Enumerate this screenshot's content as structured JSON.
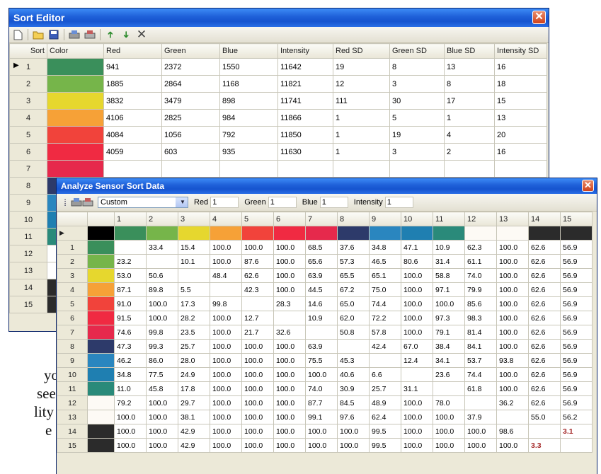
{
  "background_text": [
    "you",
    "see",
    "lity",
    "e"
  ],
  "sort_editor": {
    "title": "Sort Editor",
    "toolbar": [
      "new-icon",
      "open-icon",
      "save-icon",
      "sep",
      "scan-icon",
      "scan2-icon",
      "sep",
      "move-up-icon",
      "move-down-icon",
      "delete-icon"
    ],
    "columns": [
      "Sort",
      "Color",
      "Red",
      "Green",
      "Blue",
      "Intensity",
      "Red SD",
      "Green SD",
      "Blue SD",
      "Intensity SD"
    ],
    "rows": [
      {
        "sort": "1",
        "color": "#3a8f5b",
        "red": "941",
        "green": "2372",
        "blue": "1550",
        "intensity": "11642",
        "red_sd": "19",
        "green_sd": "8",
        "blue_sd": "13",
        "intensity_sd": "16"
      },
      {
        "sort": "2",
        "color": "#76b54a",
        "red": "1885",
        "green": "2864",
        "blue": "1168",
        "intensity": "11821",
        "red_sd": "12",
        "green_sd": "3",
        "blue_sd": "8",
        "intensity_sd": "18"
      },
      {
        "sort": "3",
        "color": "#e6d72e",
        "red": "3832",
        "green": "3479",
        "blue": "898",
        "intensity": "11741",
        "red_sd": "111",
        "green_sd": "30",
        "blue_sd": "17",
        "intensity_sd": "15"
      },
      {
        "sort": "4",
        "color": "#f6a137",
        "red": "4106",
        "green": "2825",
        "blue": "984",
        "intensity": "11866",
        "red_sd": "1",
        "green_sd": "5",
        "blue_sd": "1",
        "intensity_sd": "13"
      },
      {
        "sort": "5",
        "color": "#f1433b",
        "red": "4084",
        "green": "1056",
        "blue": "792",
        "intensity": "11850",
        "red_sd": "1",
        "green_sd": "19",
        "blue_sd": "4",
        "intensity_sd": "20"
      },
      {
        "sort": "6",
        "color": "#f02a42",
        "red": "4059",
        "green": "603",
        "blue": "935",
        "intensity": "11630",
        "red_sd": "1",
        "green_sd": "3",
        "blue_sd": "2",
        "intensity_sd": "16"
      }
    ],
    "hidden_rows": [
      {
        "sort": "7",
        "color": "#e6294c"
      },
      {
        "sort": "8",
        "color": "#2d3a6a"
      },
      {
        "sort": "9",
        "color": "#2a86bf"
      },
      {
        "sort": "10",
        "color": "#1f7fb1"
      },
      {
        "sort": "11",
        "color": "#2a8a7a"
      },
      {
        "sort": "12",
        "color": "#ffffff"
      },
      {
        "sort": "13",
        "color": "#ffffff"
      },
      {
        "sort": "14",
        "color": "#2b2b2b"
      },
      {
        "sort": "15",
        "color": "#2b2b2b"
      }
    ]
  },
  "analyze": {
    "title": "Analyze Sensor Sort Data",
    "preset": "Custom",
    "weights": [
      {
        "label": "Red",
        "value": "1"
      },
      {
        "label": "Green",
        "value": "1"
      },
      {
        "label": "Blue",
        "value": "1"
      },
      {
        "label": "Intensity",
        "value": "1"
      }
    ],
    "col_headers": [
      "1",
      "2",
      "3",
      "4",
      "5",
      "6",
      "7",
      "8",
      "9",
      "10",
      "11",
      "12",
      "13",
      "14",
      "15"
    ],
    "header_colors": [
      "#000000",
      "#3a8f5b",
      "#76b54a",
      "#e6d72e",
      "#f6a137",
      "#f1433b",
      "#f02a42",
      "#e6294c",
      "#2d3a6a",
      "#2a86bf",
      "#1f7fb1",
      "#2a8a7a",
      "#fdfaf5",
      "#fdfaf5",
      "#2b2b2b",
      "#2b2b2b"
    ],
    "rows": [
      {
        "label": "1",
        "color": "#3a8f5b",
        "cells": [
          "",
          "33.4",
          "15.4",
          "100.0",
          "100.0",
          "100.0",
          "68.5",
          "37.6",
          "34.8",
          "47.1",
          "10.9",
          "62.3",
          "100.0",
          "62.6",
          "56.9"
        ]
      },
      {
        "label": "2",
        "color": "#76b54a",
        "cells": [
          "23.2",
          "",
          "10.1",
          "100.0",
          "87.6",
          "100.0",
          "65.6",
          "57.3",
          "46.5",
          "80.6",
          "31.4",
          "61.1",
          "100.0",
          "62.6",
          "56.9"
        ]
      },
      {
        "label": "3",
        "color": "#e6d72e",
        "cells": [
          "53.0",
          "50.6",
          "",
          "48.4",
          "62.6",
          "100.0",
          "63.9",
          "65.5",
          "65.1",
          "100.0",
          "58.8",
          "74.0",
          "100.0",
          "62.6",
          "56.9"
        ]
      },
      {
        "label": "4",
        "color": "#f6a137",
        "cells": [
          "87.1",
          "89.8",
          "5.5",
          "",
          "42.3",
          "100.0",
          "44.5",
          "67.2",
          "75.0",
          "100.0",
          "97.1",
          "79.9",
          "100.0",
          "62.6",
          "56.9"
        ]
      },
      {
        "label": "5",
        "color": "#f1433b",
        "cells": [
          "91.0",
          "100.0",
          "17.3",
          "99.8",
          "",
          "28.3",
          "14.6",
          "65.0",
          "74.4",
          "100.0",
          "100.0",
          "85.6",
          "100.0",
          "62.6",
          "56.9"
        ]
      },
      {
        "label": "6",
        "color": "#f02a42",
        "cells": [
          "91.5",
          "100.0",
          "28.2",
          "100.0",
          "12.7",
          "",
          "10.9",
          "62.0",
          "72.2",
          "100.0",
          "97.3",
          "98.3",
          "100.0",
          "62.6",
          "56.9"
        ]
      },
      {
        "label": "7",
        "color": "#e6294c",
        "cells": [
          "74.6",
          "99.8",
          "23.5",
          "100.0",
          "21.7",
          "32.6",
          "",
          "50.8",
          "57.8",
          "100.0",
          "79.1",
          "81.4",
          "100.0",
          "62.6",
          "56.9"
        ]
      },
      {
        "label": "8",
        "color": "#2d3a6a",
        "cells": [
          "47.3",
          "99.3",
          "25.7",
          "100.0",
          "100.0",
          "100.0",
          "63.9",
          "",
          "42.4",
          "67.0",
          "38.4",
          "84.1",
          "100.0",
          "62.6",
          "56.9"
        ]
      },
      {
        "label": "9",
        "color": "#2a86bf",
        "cells": [
          "46.2",
          "86.0",
          "28.0",
          "100.0",
          "100.0",
          "100.0",
          "75.5",
          "45.3",
          "",
          "12.4",
          "34.1",
          "53.7",
          "93.8",
          "62.6",
          "56.9"
        ]
      },
      {
        "label": "10",
        "color": "#1f7fb1",
        "cells": [
          "34.8",
          "77.5",
          "24.9",
          "100.0",
          "100.0",
          "100.0",
          "100.0",
          "40.6",
          "6.6",
          "",
          "23.6",
          "74.4",
          "100.0",
          "62.6",
          "56.9"
        ]
      },
      {
        "label": "11",
        "color": "#2a8a7a",
        "cells": [
          "11.0",
          "45.8",
          "17.8",
          "100.0",
          "100.0",
          "100.0",
          "74.0",
          "30.9",
          "25.7",
          "31.1",
          "",
          "61.8",
          "100.0",
          "62.6",
          "56.9"
        ]
      },
      {
        "label": "12",
        "color": "#fdfaf5",
        "cells": [
          "79.2",
          "100.0",
          "29.7",
          "100.0",
          "100.0",
          "100.0",
          "87.7",
          "84.5",
          "48.9",
          "100.0",
          "78.0",
          "",
          "36.2",
          "62.6",
          "56.9"
        ]
      },
      {
        "label": "13",
        "color": "#fdfaf5",
        "cells": [
          "100.0",
          "100.0",
          "38.1",
          "100.0",
          "100.0",
          "100.0",
          "99.1",
          "97.6",
          "62.4",
          "100.0",
          "100.0",
          "37.9",
          "",
          "55.0",
          "56.2"
        ]
      },
      {
        "label": "14",
        "color": "#2b2b2b",
        "cells": [
          "100.0",
          "100.0",
          "42.9",
          "100.0",
          "100.0",
          "100.0",
          "100.0",
          "100.0",
          "99.5",
          "100.0",
          "100.0",
          "100.0",
          "98.6",
          "",
          "3.1"
        ]
      },
      {
        "label": "15",
        "color": "#2b2b2b",
        "cells": [
          "100.0",
          "100.0",
          "42.9",
          "100.0",
          "100.0",
          "100.0",
          "100.0",
          "100.0",
          "99.5",
          "100.0",
          "100.0",
          "100.0",
          "100.0",
          "3.3",
          ""
        ]
      }
    ],
    "highlights": [
      {
        "row": 13,
        "col": 14
      },
      {
        "row": 14,
        "col": 13
      }
    ]
  }
}
